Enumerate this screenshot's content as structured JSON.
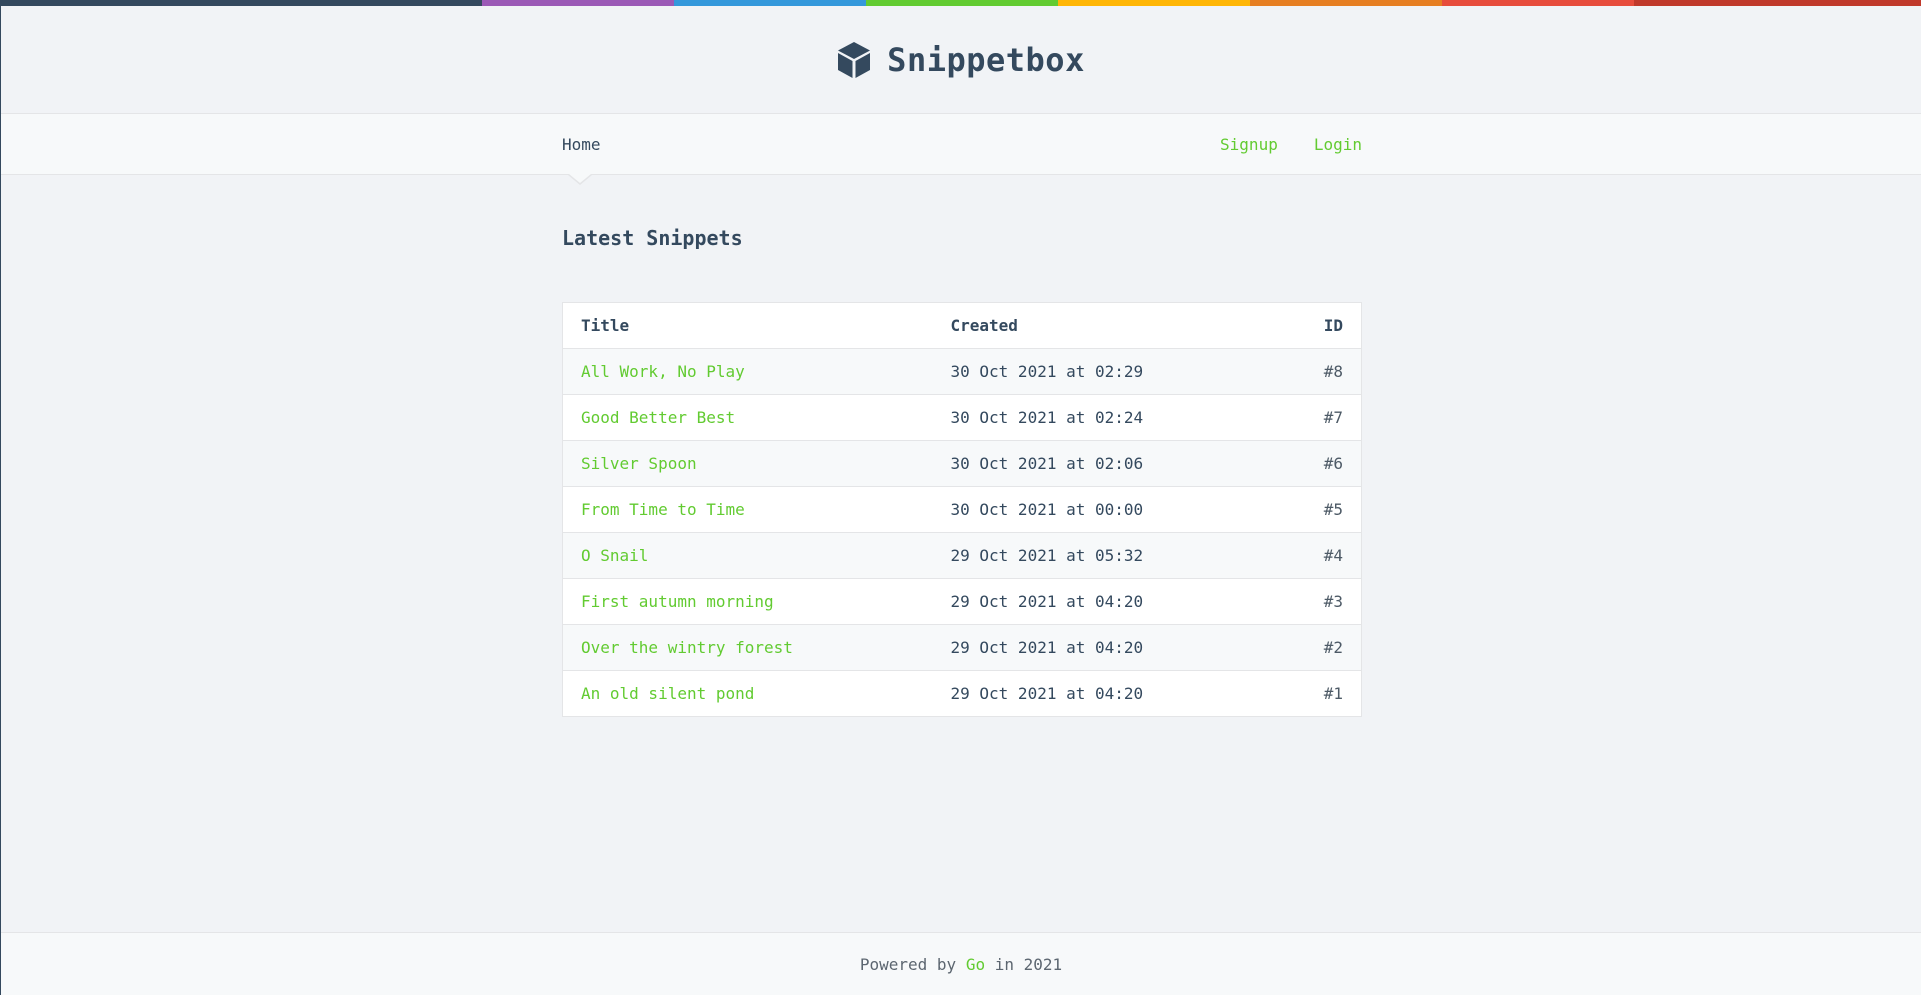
{
  "colors": {
    "accent": "#62cb31",
    "text": "#34495e",
    "stripe": [
      "#34495e",
      "#9b59b6",
      "#3498db",
      "#62cb31",
      "#ffb606",
      "#e67e22",
      "#e74c3c",
      "#c0392b"
    ]
  },
  "header": {
    "logo_icon": "cube-icon",
    "brand": "Snippetbox"
  },
  "nav": {
    "home": "Home",
    "signup": "Signup",
    "login": "Login"
  },
  "main": {
    "title": "Latest Snippets",
    "table": {
      "headers": {
        "title": "Title",
        "created": "Created",
        "id": "ID"
      },
      "rows": [
        {
          "title": "All Work, No Play",
          "created": "30 Oct 2021 at 02:29",
          "id": "#8"
        },
        {
          "title": "Good Better Best",
          "created": "30 Oct 2021 at 02:24",
          "id": "#7"
        },
        {
          "title": "Silver Spoon",
          "created": "30 Oct 2021 at 02:06",
          "id": "#6"
        },
        {
          "title": "From Time to Time",
          "created": "30 Oct 2021 at 00:00",
          "id": "#5"
        },
        {
          "title": "O Snail",
          "created": "29 Oct 2021 at 05:32",
          "id": "#4"
        },
        {
          "title": "First autumn morning",
          "created": "29 Oct 2021 at 04:20",
          "id": "#3"
        },
        {
          "title": "Over the wintry forest",
          "created": "29 Oct 2021 at 04:20",
          "id": "#2"
        },
        {
          "title": "An old silent pond",
          "created": "29 Oct 2021 at 04:20",
          "id": "#1"
        }
      ]
    }
  },
  "footer": {
    "prefix": "Powered by ",
    "link": "Go",
    "suffix": " in 2021"
  }
}
